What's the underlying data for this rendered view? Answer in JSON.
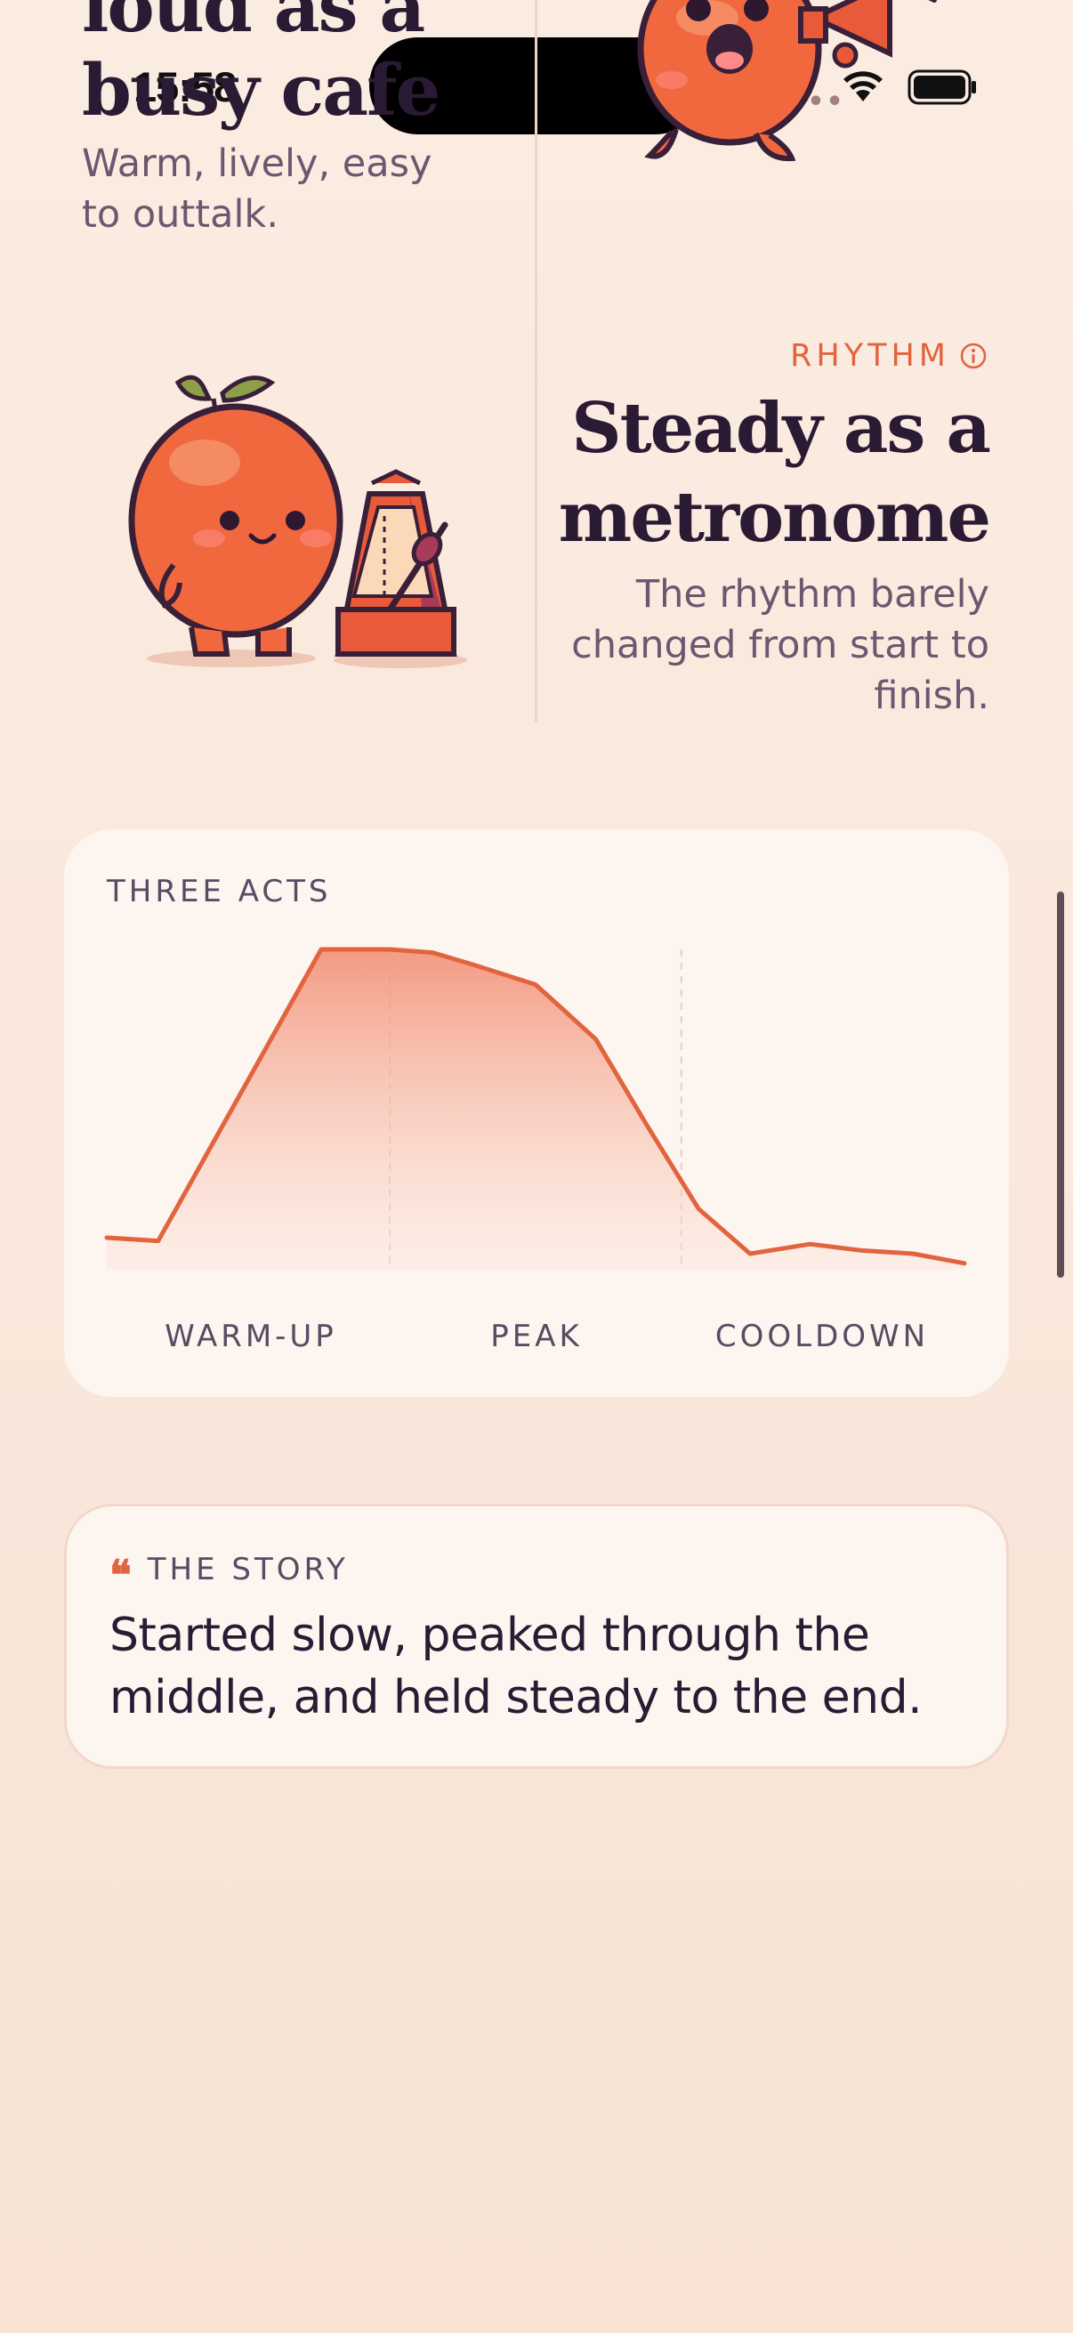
{
  "status_bar": {
    "time": "15:58",
    "signal_icon": "cellular-signal-icon",
    "wifi_icon": "wifi-icon",
    "battery_icon": "battery-icon"
  },
  "loud_section": {
    "title": "loud as a busy cafe",
    "subtitle": "Warm, lively, easy to outtalk.",
    "illustration": "peach-mascot-megaphone"
  },
  "rhythm_section": {
    "kicker": "RHYTHM",
    "info_icon": "info-icon",
    "title": "Steady as a metronome",
    "subtitle": "The rhythm barely changed from start to finish.",
    "illustration": "peach-mascot-metronome"
  },
  "chart_card": {
    "label": "THREE ACTS",
    "phases": [
      "WARM-UP",
      "PEAK",
      "COOLDOWN"
    ],
    "accent_color": "#e2643e"
  },
  "chart_data": {
    "type": "area",
    "title": "THREE ACTS",
    "xlabel": "",
    "ylabel": "",
    "x": [
      0,
      0.06,
      0.25,
      0.33,
      0.38,
      0.43,
      0.5,
      0.57,
      0.63,
      0.69,
      0.75,
      0.82,
      0.88,
      0.94,
      1.0
    ],
    "series": [
      {
        "values": [
          0.1,
          0.09,
          1.0,
          1.0,
          0.99,
          0.95,
          0.89,
          0.72,
          0.45,
          0.19,
          0.05,
          0.08,
          0.06,
          0.05,
          0.02
        ]
      }
    ],
    "ylim": [
      0,
      1
    ],
    "dividers": [
      0.33,
      0.67
    ],
    "categories": [
      "WARM-UP",
      "PEAK",
      "COOLDOWN"
    ],
    "grid": false,
    "line_color": "#e2643e"
  },
  "story_card": {
    "kicker": "THE STORY",
    "quote_icon": "quote-icon",
    "text": "Started slow, peaked through the middle, and held steady to the end."
  }
}
